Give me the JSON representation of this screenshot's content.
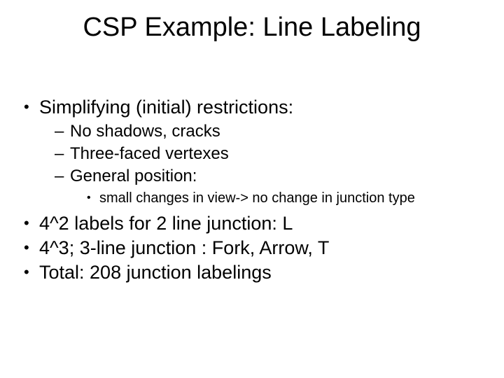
{
  "title": "CSP Example: Line Labeling",
  "bullets": {
    "b1": "Simplifying (initial) restrictions:",
    "b1a": "No shadows, cracks",
    "b1b": "Three-faced vertexes",
    "b1c": "General position:",
    "b1c1": "small changes in view-> no change in junction type",
    "b2": "4^2 labels for 2 line junction: L",
    "b3": "4^3; 3-line junction : Fork, Arrow, T",
    "b4": "Total: 208 junction labelings"
  }
}
